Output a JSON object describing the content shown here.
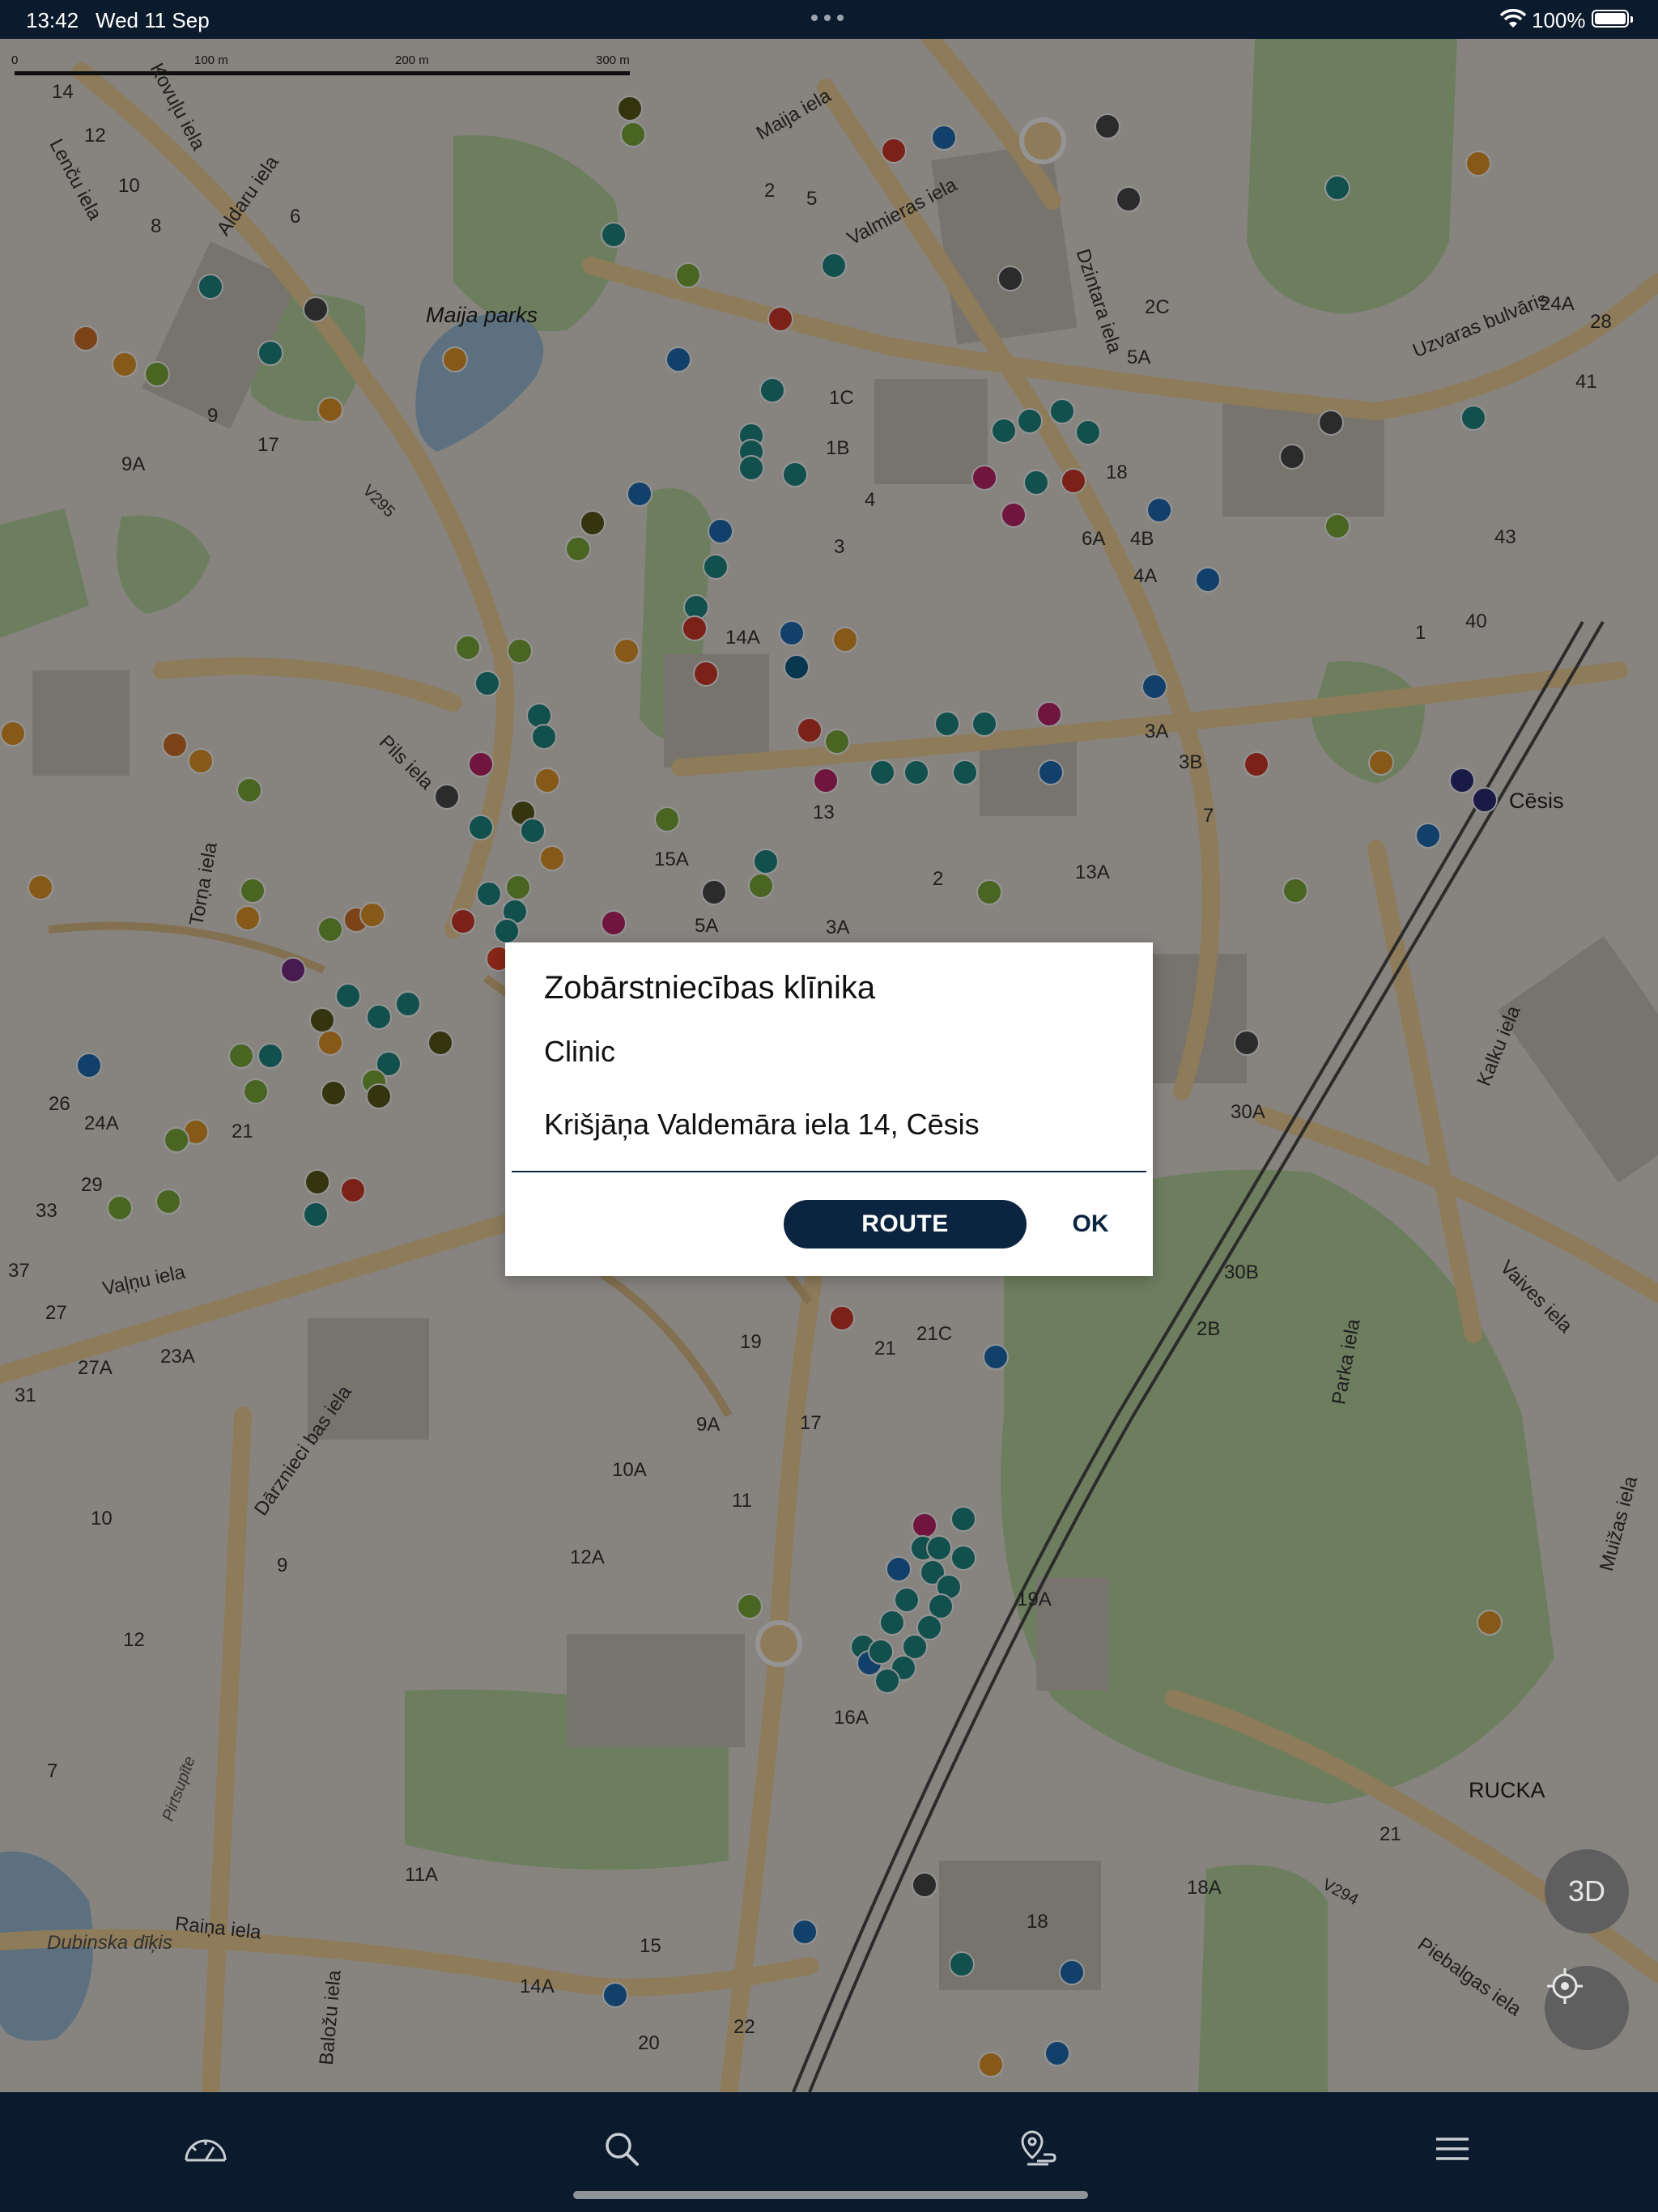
{
  "status_bar": {
    "time": "13:42",
    "date": "Wed 11 Sep",
    "battery": "100%"
  },
  "map": {
    "scale": [
      "0",
      "100 m",
      "200 m",
      "300 m"
    ],
    "labels": {
      "maija_parks": "Maija parks",
      "maija_iela": "Maija iela",
      "valmieras_iela": "Valmieras iela",
      "dzintara_iela": "Dzintara iela",
      "uzvaras_bulvaris": "Uzvaras bulvāris",
      "kovulu_iela": "Kovuļu iela",
      "lencu_iela": "Lenču iela",
      "aldaru_iela": "Aldaru iela",
      "pils_iela": "Pils iela",
      "torna_iela": "Torņa iela",
      "valnu_iela": "Vaļņu iela",
      "darznieci_iela": "Dārznieci bas iela",
      "parka_iela": "Parka iela",
      "kalku_iela": "Kalku iela",
      "vaives_iela": "Vaives iela",
      "muizas_iela": "Muižas iela",
      "raina_iela": "Raiņa iela",
      "balozu_iela": "Baložu iela",
      "piebalgas_iela": "Piebalgas iela",
      "rucka": "RUCKA",
      "cesis": "Cēsis",
      "dubinska_diks": "Dubinska dīķis",
      "v294": "V294",
      "v295": "V295",
      "pirtsupite": "Pirtsupīte"
    },
    "house_numbers": [
      "14",
      "12",
      "10",
      "8",
      "9",
      "9A",
      "6",
      "17",
      "2",
      "5",
      "1C",
      "1B",
      "4",
      "3",
      "14A",
      "13",
      "15A",
      "5A",
      "3A",
      "2",
      "13A",
      "6A",
      "4B",
      "4A",
      "3A",
      "3B",
      "7",
      "1",
      "40",
      "43",
      "28",
      "41",
      "24A",
      "2C",
      "5A",
      "18",
      "12",
      "30A",
      "30B",
      "2B",
      "21C",
      "21",
      "19",
      "17",
      "9A",
      "11",
      "12A",
      "10A",
      "16A",
      "19A",
      "22",
      "20",
      "15",
      "14A",
      "11A",
      "18",
      "18A",
      "21",
      "26",
      "24A",
      "21",
      "29",
      "33",
      "37",
      "27",
      "27A",
      "23A",
      "31",
      "10",
      "12",
      "7",
      "9"
    ],
    "three_d_label": "3D"
  },
  "dialog": {
    "title": "Zobārstniecības klīnika",
    "subtitle": "Clinic",
    "address": "Krišjāņa Valdemāra iela 14, Cēsis",
    "route_label": "ROUTE",
    "ok_label": "OK"
  },
  "tabs": [
    {
      "icon": "speedometer-icon"
    },
    {
      "icon": "search-icon"
    },
    {
      "icon": "route-pin-icon"
    },
    {
      "icon": "menu-icon"
    }
  ],
  "colors": {
    "status_bar_bg": "#0b1a2c",
    "tab_bar_bg": "#0b1a2c",
    "accent": "#0b2540",
    "poi_teal": "#1f8a86",
    "poi_orange": "#e89a2a",
    "poi_red": "#d63a2a",
    "poi_green": "#7eae3a",
    "poi_pink": "#c2266b"
  }
}
